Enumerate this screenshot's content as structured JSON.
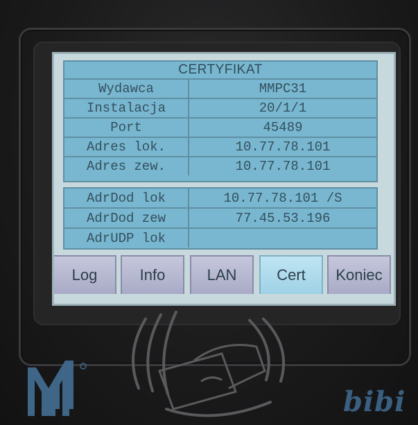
{
  "certificate": {
    "title": "CERTYFIKAT",
    "rows": [
      {
        "label": "Wydawca",
        "value": "MMPC31"
      },
      {
        "label": "Instalacja",
        "value": "20/1/1"
      },
      {
        "label": "Port",
        "value": "45489"
      },
      {
        "label": "Adres lok.",
        "value": "10.77.78.101"
      },
      {
        "label": "Adres zew.",
        "value": "10.77.78.101"
      }
    ],
    "extra_rows": [
      {
        "label": "AdrDod lok",
        "value": "10.77.78.101 /S"
      },
      {
        "label": "AdrDod zew",
        "value": "77.45.53.196"
      },
      {
        "label": "AdrUDP lok",
        "value": ""
      }
    ]
  },
  "tabs": [
    {
      "label": "Log",
      "active": false
    },
    {
      "label": "Info",
      "active": false
    },
    {
      "label": "LAN",
      "active": false
    },
    {
      "label": "Cert",
      "active": true
    },
    {
      "label": "Koniec",
      "active": false
    }
  ],
  "branding": {
    "right_logo": "bibi",
    "left_logo": "mm-logo-icon"
  },
  "colors": {
    "panel": "#79b7d0",
    "active_tab": "#a9d8ea",
    "tab": "#b8b9d3"
  }
}
